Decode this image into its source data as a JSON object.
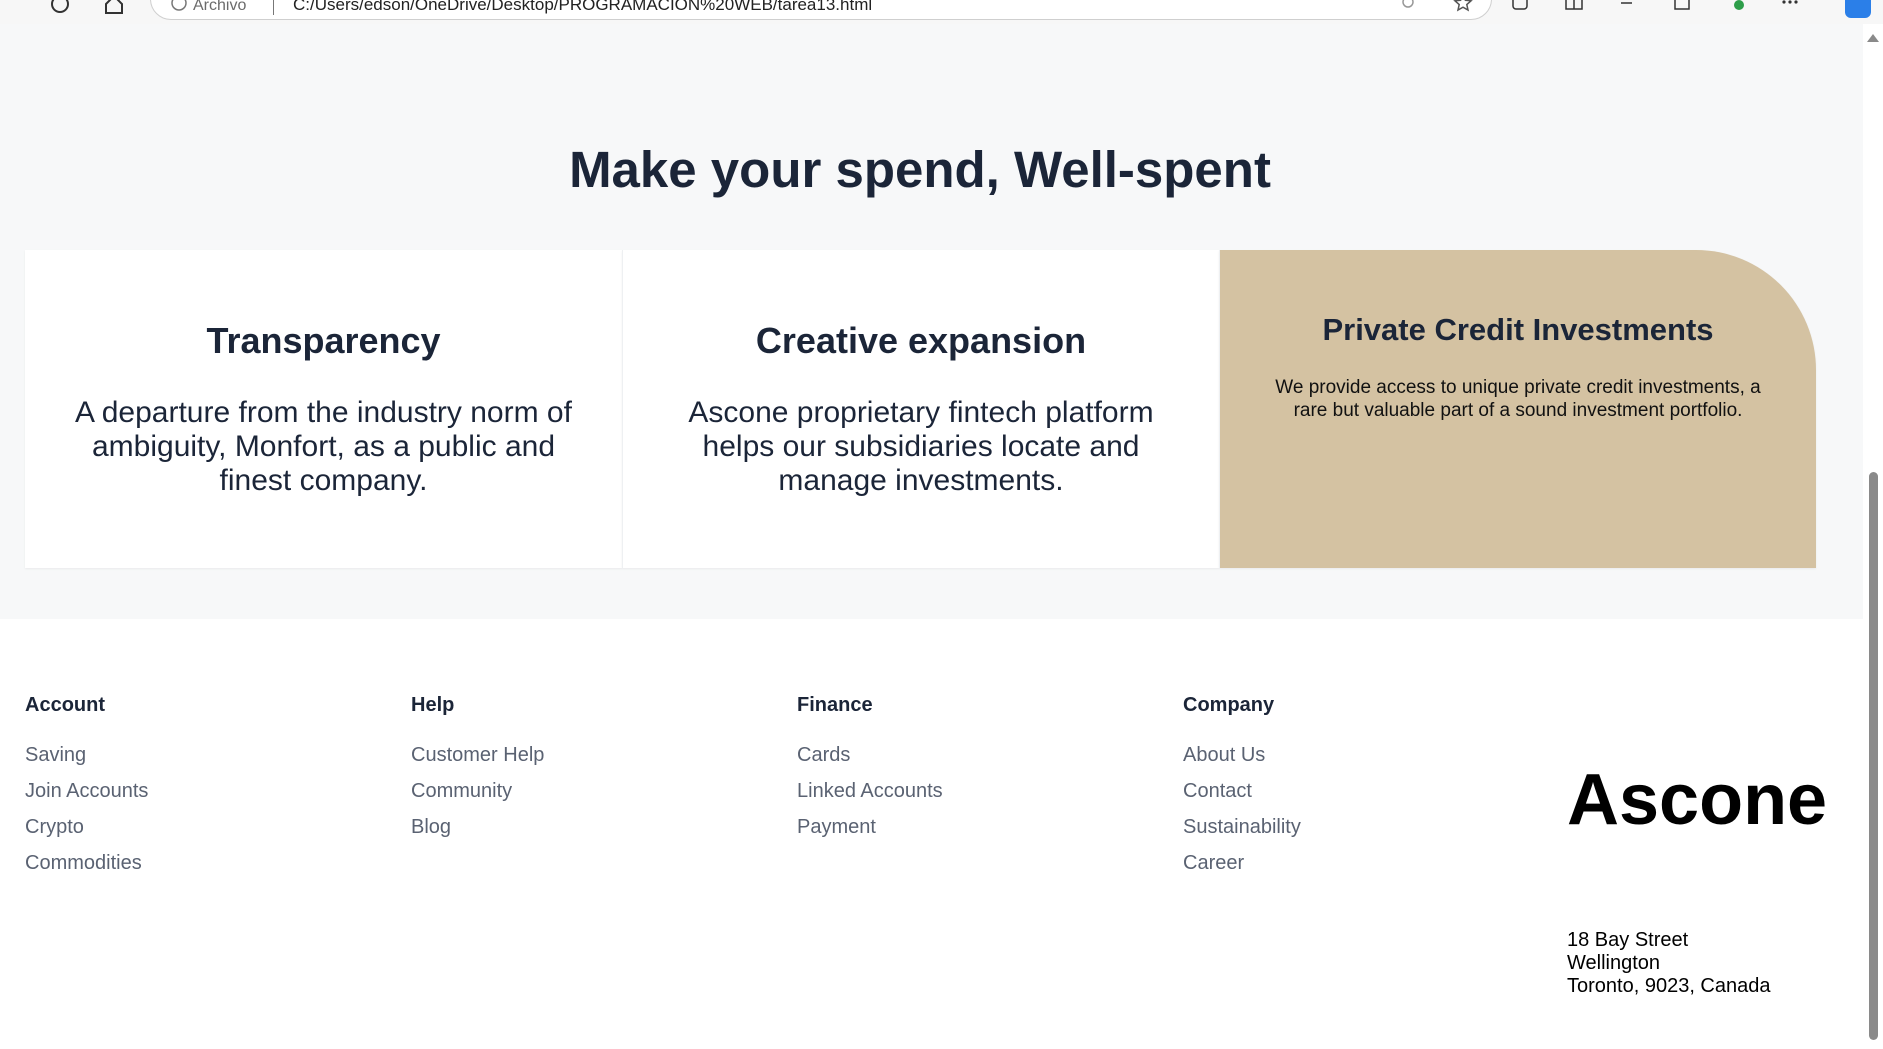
{
  "browser": {
    "address_info_label": "Archivo",
    "url": "C:/Users/edson/OneDrive/Desktop/PROGRAMACION%20WEB/tarea13.html"
  },
  "section": {
    "title": "Make your spend, Well-spent",
    "cards": [
      {
        "title": "Transparency",
        "text": "A departure from the industry norm of ambiguity, Monfort, as a public and finest company."
      },
      {
        "title": "Creative expansion",
        "text": "Ascone proprietary fintech platform helps our subsidiaries locate and manage investments."
      },
      {
        "title": "Private Credit Investments",
        "text": "We provide access to unique private credit investments, a rare but valuable part of a sound investment portfolio."
      }
    ]
  },
  "footer": {
    "columns": [
      {
        "heading": "Account",
        "links": [
          "Saving",
          "Join Accounts",
          "Crypto",
          "Commodities"
        ]
      },
      {
        "heading": "Help",
        "links": [
          "Customer Help",
          "Community",
          "Blog"
        ]
      },
      {
        "heading": "Finance",
        "links": [
          "Cards",
          "Linked Accounts",
          "Payment"
        ]
      },
      {
        "heading": "Company",
        "links": [
          "About Us",
          "Contact",
          "Sustainability",
          "Career"
        ]
      }
    ],
    "brand": "Ascone",
    "address": [
      "18 Bay Street",
      "Wellington",
      "Toronto, 9023, Canada"
    ]
  },
  "colors": {
    "heading": "#1b2538",
    "link": "#5a6272",
    "highlight_card": "#d4c2a2",
    "section_bg": "#f7f8f9"
  }
}
